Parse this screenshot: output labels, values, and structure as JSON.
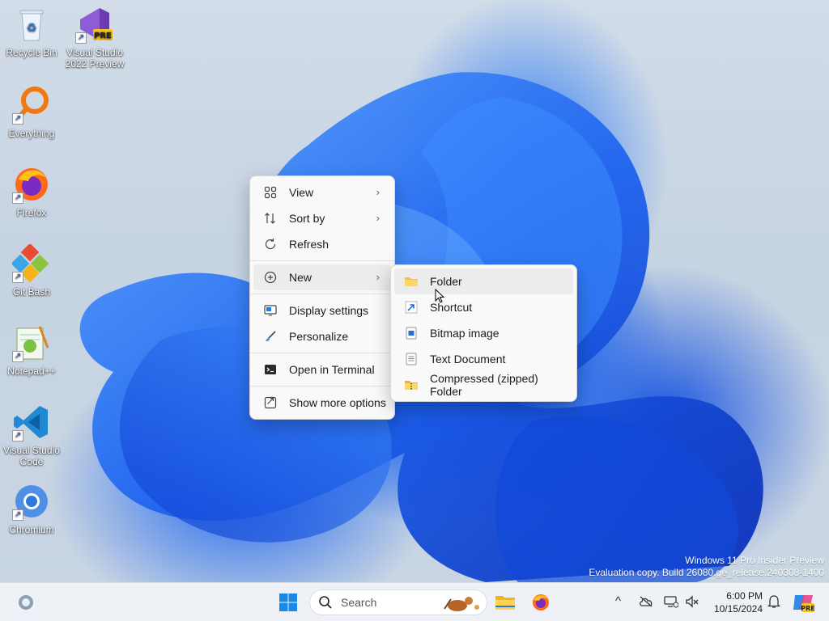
{
  "desktop": {
    "icons": [
      {
        "label": "Recycle Bin"
      },
      {
        "label": "Visual Studio 2022 Preview",
        "badge": "PRE"
      },
      {
        "label": "Everything"
      },
      {
        "label": "Firefox"
      },
      {
        "label": "Git Bash"
      },
      {
        "label": "Notepad++"
      },
      {
        "label": "Visual Studio Code"
      },
      {
        "label": "Chromium"
      }
    ]
  },
  "context_menu": {
    "items": [
      {
        "label": "View",
        "icon": "grid-icon",
        "submenu": true
      },
      {
        "label": "Sort by",
        "icon": "sort-icon",
        "submenu": true
      },
      {
        "label": "Refresh",
        "icon": "refresh-icon",
        "submenu": false
      },
      {
        "label": "New",
        "icon": "plus-circle-icon",
        "submenu": true
      },
      {
        "label": "Display settings",
        "icon": "display-icon",
        "submenu": false
      },
      {
        "label": "Personalize",
        "icon": "brush-icon",
        "submenu": false
      },
      {
        "label": "Open in Terminal",
        "icon": "terminal-icon",
        "submenu": false
      },
      {
        "label": "Show more options",
        "icon": "more-options-icon",
        "submenu": false
      }
    ]
  },
  "new_submenu": {
    "items": [
      {
        "label": "Folder",
        "icon": "folder-icon"
      },
      {
        "label": "Shortcut",
        "icon": "shortcut-icon"
      },
      {
        "label": "Bitmap image",
        "icon": "bitmap-icon"
      },
      {
        "label": "Text Document",
        "icon": "text-document-icon"
      },
      {
        "label": "Compressed (zipped) Folder",
        "icon": "zip-folder-icon"
      }
    ]
  },
  "watermark": {
    "line1": "Windows 11 Pro Insider Preview",
    "line2": "Evaluation copy. Build 26080.ge_release.240308-1400"
  },
  "taskbar": {
    "search_placeholder": "Search",
    "time": "6:00 PM",
    "date": "10/15/2024",
    "copilot_badge": "PRE"
  },
  "colors": {
    "accent": "#0067c0",
    "menu_bg": "#f9f9f9",
    "taskbar_bg": "#eef1f5"
  }
}
